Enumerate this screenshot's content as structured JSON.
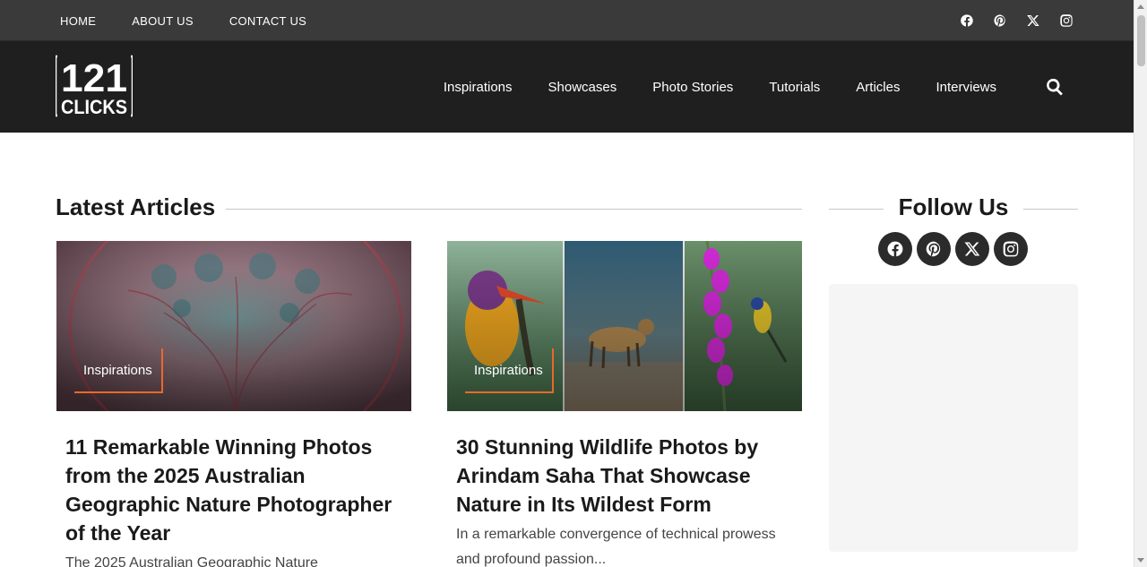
{
  "top_nav": {
    "items": [
      "HOME",
      "ABOUT US",
      "CONTACT US"
    ]
  },
  "top_social": [
    "facebook-icon",
    "pinterest-icon",
    "x-icon",
    "instagram-icon"
  ],
  "header": {
    "logo": {
      "line1": "121",
      "line2": "CLICKS"
    },
    "nav": [
      "Inspirations",
      "Showcases",
      "Photo Stories",
      "Tutorials",
      "Articles",
      "Interviews"
    ],
    "search_icon": "search-icon"
  },
  "latest": {
    "heading": "Latest Articles",
    "cards": [
      {
        "category": "Inspirations",
        "title": "11 Remarkable Winning Photos from the 2025 Australian Geographic Nature Photographer of the Year",
        "excerpt": "The 2025 Australian Geographic Nature"
      },
      {
        "category": "Inspirations",
        "title": "30 Stunning Wildlife Photos by Arindam Saha That Showcase Nature in Its Wildest Form",
        "excerpt": "In a remarkable convergence of technical prowess and profound passion..."
      }
    ]
  },
  "sidebar": {
    "follow_heading": "Follow Us",
    "social": [
      "facebook-icon",
      "pinterest-icon",
      "x-icon",
      "instagram-icon"
    ]
  },
  "colors": {
    "topbar": "#3a3a3a",
    "header": "#1f1f1f",
    "accent": "#e8692b"
  }
}
